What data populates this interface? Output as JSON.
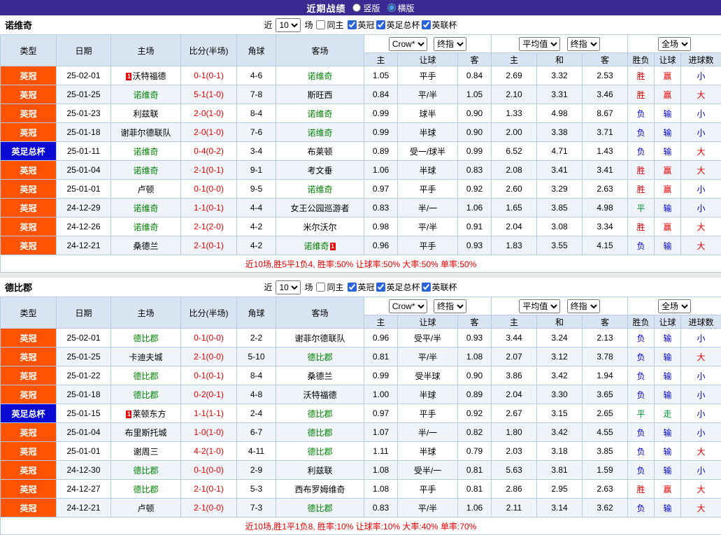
{
  "top_bar": {
    "title": "近期战绩",
    "layout_options": [
      {
        "label": "竖版",
        "selected": false
      },
      {
        "label": "横版",
        "selected": true
      }
    ]
  },
  "tables": [
    {
      "team": "诺维奇",
      "controls": {
        "prefix": "近",
        "count": "10",
        "suffix": "场",
        "same_home": {
          "label": "同主",
          "checked": false
        },
        "leagues": [
          {
            "label": "英冠",
            "checked": true
          },
          {
            "label": "英足总杯",
            "checked": true
          },
          {
            "label": "英联杯",
            "checked": true
          }
        ]
      },
      "header": {
        "type": "类型",
        "date": "日期",
        "home": "主场",
        "score": "比分(半场)",
        "corners": "角球",
        "away": "客场",
        "odds_selects": [
          "Crow*",
          "终指"
        ],
        "avg_selects": [
          "平均值",
          "终指"
        ],
        "scope_selects": [
          "全场"
        ],
        "odds_sub": [
          "主",
          "让球",
          "客"
        ],
        "avg_sub": [
          "主",
          "和",
          "客"
        ],
        "scope_sub": [
          "胜负",
          "让球",
          "进球数"
        ]
      },
      "rows": [
        {
          "type": "英冠",
          "date": "25-02-01",
          "home": {
            "name": "沃特福德",
            "card": "1",
            "card_pos": "before"
          },
          "score": "0-1(0-1)",
          "corners": "4-6",
          "away": {
            "name": "诺维奇"
          },
          "odds": [
            "1.05",
            "平手",
            "0.84"
          ],
          "avg": [
            "2.69",
            "3.32",
            "2.53"
          ],
          "results": [
            "胜",
            "赢",
            "小"
          ]
        },
        {
          "type": "英冠",
          "date": "25-01-25",
          "home": {
            "name": "诺维奇"
          },
          "score": "5-1(1-0)",
          "corners": "7-8",
          "away": {
            "name": "斯旺西"
          },
          "odds": [
            "0.84",
            "平/半",
            "1.05"
          ],
          "avg": [
            "2.10",
            "3.31",
            "3.46"
          ],
          "results": [
            "胜",
            "赢",
            "大"
          ]
        },
        {
          "type": "英冠",
          "date": "25-01-23",
          "home": {
            "name": "利兹联"
          },
          "score": "2-0(1-0)",
          "corners": "8-4",
          "away": {
            "name": "诺维奇"
          },
          "odds": [
            "0.99",
            "球半",
            "0.90"
          ],
          "avg": [
            "1.33",
            "4.98",
            "8.67"
          ],
          "results": [
            "负",
            "输",
            "小"
          ]
        },
        {
          "type": "英冠",
          "date": "25-01-18",
          "home": {
            "name": "谢菲尔德联队"
          },
          "score": "2-0(1-0)",
          "corners": "7-6",
          "away": {
            "name": "诺维奇"
          },
          "odds": [
            "0.99",
            "半球",
            "0.90"
          ],
          "avg": [
            "2.00",
            "3.38",
            "3.71"
          ],
          "results": [
            "负",
            "输",
            "小"
          ]
        },
        {
          "type": "英足总杯",
          "date": "25-01-11",
          "home": {
            "name": "诺维奇"
          },
          "score": "0-4(0-2)",
          "corners": "3-4",
          "away": {
            "name": "布莱顿"
          },
          "odds": [
            "0.89",
            "受一/球半",
            "0.99"
          ],
          "avg": [
            "6.52",
            "4.71",
            "1.43"
          ],
          "results": [
            "负",
            "输",
            "大"
          ]
        },
        {
          "type": "英冠",
          "date": "25-01-04",
          "home": {
            "name": "诺维奇"
          },
          "score": "2-1(0-1)",
          "corners": "9-1",
          "away": {
            "name": "考文垂"
          },
          "odds": [
            "1.06",
            "半球",
            "0.83"
          ],
          "avg": [
            "2.08",
            "3.41",
            "3.41"
          ],
          "results": [
            "胜",
            "赢",
            "大"
          ]
        },
        {
          "type": "英冠",
          "date": "25-01-01",
          "home": {
            "name": "卢顿"
          },
          "score": "0-1(0-0)",
          "corners": "9-5",
          "away": {
            "name": "诺维奇"
          },
          "odds": [
            "0.97",
            "平手",
            "0.92"
          ],
          "avg": [
            "2.60",
            "3.29",
            "2.63"
          ],
          "results": [
            "胜",
            "赢",
            "小"
          ]
        },
        {
          "type": "英冠",
          "date": "24-12-29",
          "home": {
            "name": "诺维奇"
          },
          "score": "1-1(0-1)",
          "corners": "4-4",
          "away": {
            "name": "女王公园巡游者"
          },
          "odds": [
            "0.83",
            "半/一",
            "1.06"
          ],
          "avg": [
            "1.65",
            "3.85",
            "4.98"
          ],
          "results": [
            "平",
            "输",
            "小"
          ]
        },
        {
          "type": "英冠",
          "date": "24-12-26",
          "home": {
            "name": "诺维奇"
          },
          "score": "2-1(2-0)",
          "corners": "4-2",
          "away": {
            "name": "米尔沃尔"
          },
          "odds": [
            "0.98",
            "平/半",
            "0.91"
          ],
          "avg": [
            "2.04",
            "3.08",
            "3.34"
          ],
          "results": [
            "胜",
            "赢",
            "大"
          ]
        },
        {
          "type": "英冠",
          "date": "24-12-21",
          "home": {
            "name": "桑德兰"
          },
          "score": "2-1(0-1)",
          "corners": "4-2",
          "away": {
            "name": "诺维奇",
            "card": "1",
            "card_pos": "after"
          },
          "odds": [
            "0.96",
            "平手",
            "0.93"
          ],
          "avg": [
            "1.83",
            "3.55",
            "4.15"
          ],
          "results": [
            "负",
            "输",
            "大"
          ]
        }
      ],
      "footer": "近10场,胜5平1负4, 胜率:50% 让球率:50% 大率:50% 单率:50%"
    },
    {
      "team": "德比郡",
      "controls": {
        "prefix": "近",
        "count": "10",
        "suffix": "场",
        "same_home": {
          "label": "同主",
          "checked": false
        },
        "leagues": [
          {
            "label": "英冠",
            "checked": true
          },
          {
            "label": "英足总杯",
            "checked": true
          },
          {
            "label": "英联杯",
            "checked": true
          }
        ]
      },
      "header": {
        "type": "类型",
        "date": "日期",
        "home": "主场",
        "score": "比分(半场)",
        "corners": "角球",
        "away": "客场",
        "odds_selects": [
          "Crow*",
          "终指"
        ],
        "avg_selects": [
          "平均值",
          "终指"
        ],
        "scope_selects": [
          "全场"
        ],
        "odds_sub": [
          "主",
          "让球",
          "客"
        ],
        "avg_sub": [
          "主",
          "和",
          "客"
        ],
        "scope_sub": [
          "胜负",
          "让球",
          "进球数"
        ]
      },
      "rows": [
        {
          "type": "英冠",
          "date": "25-02-01",
          "home": {
            "name": "德比郡"
          },
          "score": "0-1(0-0)",
          "corners": "2-2",
          "away": {
            "name": "谢菲尔德联队"
          },
          "odds": [
            "0.96",
            "受平/半",
            "0.93"
          ],
          "avg": [
            "3.44",
            "3.24",
            "2.13"
          ],
          "results": [
            "负",
            "输",
            "小"
          ]
        },
        {
          "type": "英冠",
          "date": "25-01-25",
          "home": {
            "name": "卡迪夫城"
          },
          "score": "2-1(0-0)",
          "corners": "5-10",
          "away": {
            "name": "德比郡"
          },
          "odds": [
            "0.81",
            "平/半",
            "1.08"
          ],
          "avg": [
            "2.07",
            "3.12",
            "3.78"
          ],
          "results": [
            "负",
            "输",
            "大"
          ]
        },
        {
          "type": "英冠",
          "date": "25-01-22",
          "home": {
            "name": "德比郡"
          },
          "score": "0-1(0-1)",
          "corners": "8-4",
          "away": {
            "name": "桑德兰"
          },
          "odds": [
            "0.99",
            "受半球",
            "0.90"
          ],
          "avg": [
            "3.86",
            "3.42",
            "1.94"
          ],
          "results": [
            "负",
            "输",
            "小"
          ]
        },
        {
          "type": "英冠",
          "date": "25-01-18",
          "home": {
            "name": "德比郡"
          },
          "score": "0-2(0-1)",
          "corners": "4-8",
          "away": {
            "name": "沃特福德"
          },
          "odds": [
            "1.00",
            "半球",
            "0.89"
          ],
          "avg": [
            "2.04",
            "3.30",
            "3.65"
          ],
          "results": [
            "负",
            "输",
            "小"
          ]
        },
        {
          "type": "英足总杯",
          "date": "25-01-15",
          "home": {
            "name": "莱顿东方",
            "card": "1",
            "card_pos": "before"
          },
          "score": "1-1(1-1)",
          "corners": "2-4",
          "away": {
            "name": "德比郡"
          },
          "odds": [
            "0.97",
            "平手",
            "0.92"
          ],
          "avg": [
            "2.67",
            "3.15",
            "2.65"
          ],
          "results": [
            "平",
            "走",
            "小"
          ]
        },
        {
          "type": "英冠",
          "date": "25-01-04",
          "home": {
            "name": "布里斯托城"
          },
          "score": "1-0(1-0)",
          "corners": "6-7",
          "away": {
            "name": "德比郡"
          },
          "odds": [
            "1.07",
            "半/一",
            "0.82"
          ],
          "avg": [
            "1.80",
            "3.42",
            "4.55"
          ],
          "results": [
            "负",
            "输",
            "小"
          ]
        },
        {
          "type": "英冠",
          "date": "25-01-01",
          "home": {
            "name": "谢周三"
          },
          "score": "4-2(1-0)",
          "corners": "4-11",
          "away": {
            "name": "德比郡"
          },
          "odds": [
            "1.11",
            "半球",
            "0.79"
          ],
          "avg": [
            "2.03",
            "3.18",
            "3.85"
          ],
          "results": [
            "负",
            "输",
            "大"
          ]
        },
        {
          "type": "英冠",
          "date": "24-12-30",
          "home": {
            "name": "德比郡"
          },
          "score": "0-1(0-0)",
          "corners": "2-9",
          "away": {
            "name": "利兹联"
          },
          "odds": [
            "1.08",
            "受半/一",
            "0.81"
          ],
          "avg": [
            "5.63",
            "3.81",
            "1.59"
          ],
          "results": [
            "负",
            "输",
            "小"
          ]
        },
        {
          "type": "英冠",
          "date": "24-12-27",
          "home": {
            "name": "德比郡"
          },
          "score": "2-1(0-1)",
          "corners": "5-3",
          "away": {
            "name": "西布罗姆维奇"
          },
          "odds": [
            "1.08",
            "平手",
            "0.81"
          ],
          "avg": [
            "2.86",
            "2.95",
            "2.63"
          ],
          "results": [
            "胜",
            "赢",
            "大"
          ]
        },
        {
          "type": "英冠",
          "date": "24-12-21",
          "home": {
            "name": "卢顿"
          },
          "score": "2-1(0-0)",
          "corners": "7-3",
          "away": {
            "name": "德比郡"
          },
          "odds": [
            "0.83",
            "平/半",
            "1.06"
          ],
          "avg": [
            "2.11",
            "3.14",
            "3.62"
          ],
          "results": [
            "负",
            "输",
            "大"
          ]
        }
      ],
      "footer": "近10场,胜1平1负8, 胜率:10% 让球率:10% 大率:40% 单率:70%"
    }
  ]
}
